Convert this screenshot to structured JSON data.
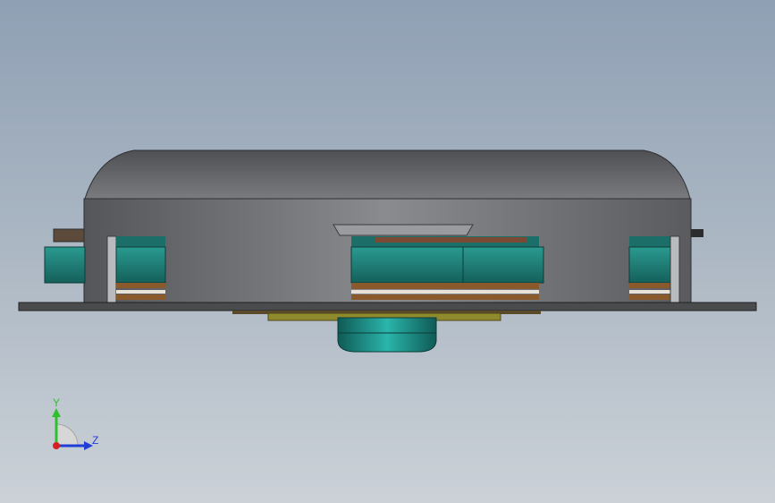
{
  "viewport": {
    "background_top": "#8fa0b4",
    "background_bottom": "#cbd1d7"
  },
  "model": {
    "housing_color": "#5f6063",
    "dome_color": "#6d6e71",
    "base_plate_color": "#4a4b4d",
    "component_teal": "#1e7f78",
    "board_brown": "#8a5a2c",
    "underside_gold": "#8f8a2e",
    "connector_teal": "#1aa39a"
  },
  "triad": {
    "y_label": "Y",
    "z_label": "Z",
    "y_color": "#2fbf2f",
    "z_color": "#1f3fd6",
    "x_color": "#d62020"
  }
}
